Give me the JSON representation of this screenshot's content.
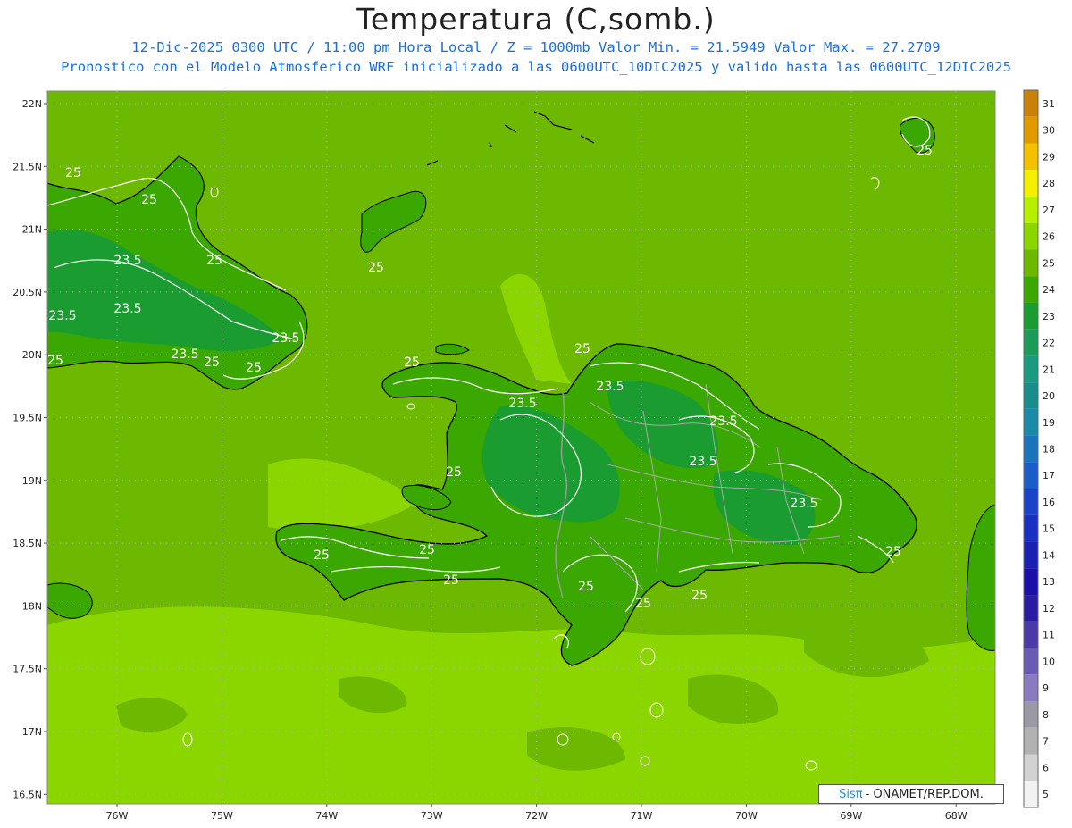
{
  "header": {
    "title": "Temperatura (C,somb.)",
    "line1": "12-Dic-2025 0300 UTC / 11:00 pm Hora Local / Z = 1000mb  Valor Min. = 21.5949  Valor Max. = 27.2709",
    "line2": "Pronostico con el Modelo Atmosferico WRF inicializado a las 0600UTC_10DIC2025 y valido hasta las  0600UTC_12DIC2025"
  },
  "axes": {
    "lat_labels": [
      "22N",
      "21.5N",
      "21N",
      "20.5N",
      "20N",
      "19.5N",
      "19N",
      "18.5N",
      "18N",
      "17.5N",
      "17N",
      "16.5N"
    ],
    "lon_labels": [
      "76W",
      "75W",
      "74W",
      "73W",
      "72W",
      "71W",
      "70W",
      "69W",
      "68W"
    ]
  },
  "colorbar": {
    "labels": [
      "31",
      "30",
      "29",
      "28",
      "27",
      "26",
      "25",
      "24",
      "23",
      "22",
      "21",
      "20",
      "19",
      "18",
      "17",
      "16",
      "15",
      "14",
      "13",
      "12",
      "11",
      "10",
      "9",
      "8",
      "7",
      "6",
      "5"
    ],
    "colors": [
      "#c8820a",
      "#e09a00",
      "#f5c000",
      "#f5f000",
      "#b6f000",
      "#8cd600",
      "#6db800",
      "#3aa800",
      "#1a9c30",
      "#1c9a58",
      "#1c9a80",
      "#1a8c8c",
      "#1a8aa8",
      "#1a74bc",
      "#1a5cc8",
      "#1a44c8",
      "#1a30c0",
      "#1a20b0",
      "#1a10a8",
      "#2a1ca0",
      "#4a3aa8",
      "#6a5ab4",
      "#8a7ac0",
      "#9a9aa4",
      "#b2b2b2",
      "#d2d2d2",
      "#f2f2f2"
    ]
  },
  "contours": [
    "25",
    "25",
    "25",
    "25",
    "25",
    "25",
    "25",
    "25",
    "25",
    "25",
    "25",
    "25",
    "25",
    "25",
    "25",
    "25",
    "23.5",
    "23.5",
    "23.5",
    "23.5",
    "23.5",
    "23.5",
    "23.5",
    "23.5",
    "23.5",
    "23.5"
  ],
  "credit": {
    "brand": "Sisπ",
    "text": "- ONAMET/REP.DOM."
  },
  "palette": {
    "sea": "#6db800",
    "sea_warm": "#8cd600",
    "land": "#3aa800",
    "land_cool": "#1a9c30",
    "coast": "#000000",
    "border": "#9a9a9a",
    "contour": "#ffffff"
  }
}
